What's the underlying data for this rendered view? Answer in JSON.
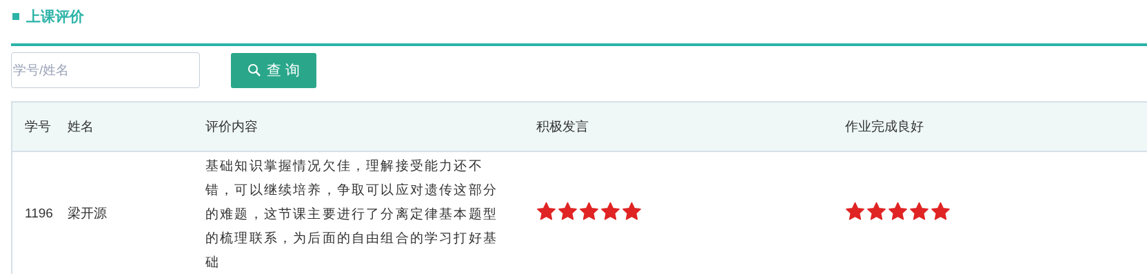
{
  "section": {
    "title": "上课评价"
  },
  "search": {
    "placeholder": "学号/姓名",
    "button": "查 询"
  },
  "table": {
    "columns": [
      "学号",
      "姓名",
      "评价内容",
      "积极发言",
      "作业完成良好"
    ],
    "rows": [
      {
        "id": "1196",
        "name": "梁开源",
        "comment": "基础知识掌握情况欠佳，理解接受能力还不错，可以继续培养，争取可以应对遗传这部分的难题，这节课主要进行了分离定律基本题型的梳理联系，为后面的自由组合的学习打好基础",
        "ratings": [
          {
            "stars": 5
          },
          {
            "stars": 5
          }
        ]
      }
    ]
  }
}
